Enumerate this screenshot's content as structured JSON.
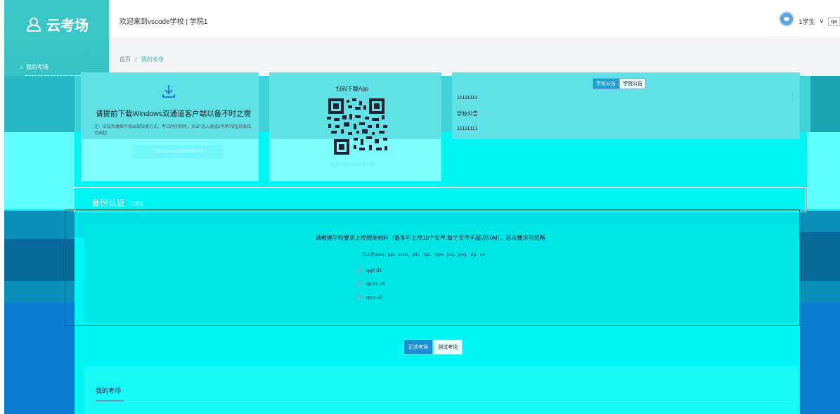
{
  "app": {
    "logo_text": "云考场"
  },
  "sidebar": {
    "items": [
      {
        "label": "我的考场",
        "icon": "home-icon"
      }
    ]
  },
  "header": {
    "welcome": "欢迎来到vscode学校 | 学院1",
    "user_name": "1学生",
    "lang": "qa"
  },
  "breadcrumb": {
    "home": "首页",
    "separator": "/",
    "current": "我的考场"
  },
  "download_card": {
    "title": "请提前下载Windows双通道客户端以备不时之需",
    "note": "注：安装后桌面不会出现快捷方式。考试时间到时，点击“进入通道2考场”按钮后会自动调起",
    "button": "下载Windows双通道客户端"
  },
  "app_card": {
    "title": "扫码下载App",
    "android_link": "本地下载Android客户端"
  },
  "notice_card": {
    "tabs": [
      "学校公告",
      "学院公告"
    ],
    "active_tab": 0,
    "items": [
      "11111111",
      "学校公告",
      "11111111"
    ]
  },
  "identity": {
    "title": "身份认证",
    "subtitle": "已提交"
  },
  "upload": {
    "main_text": "请根据学校要求上传相关材料（最多可上传10个文件,每个文件不超过50M），若未要求可忽略",
    "types_text": "可上传word、ppt、excel、pdf、mp3、mp4、png、jpeg、zip、rar",
    "files": [
      "qgif.dll",
      "qicns.dll",
      "qico.dll"
    ]
  },
  "exam_tabs": {
    "tabs": [
      "正式考场",
      "测试考场"
    ],
    "active": 0
  },
  "my_exam": {
    "title": "我的考场"
  },
  "colors": {
    "sidebar": "#31c0c4",
    "accent": "#1a9fd0",
    "overlay_cyan": "#00f5f5"
  }
}
